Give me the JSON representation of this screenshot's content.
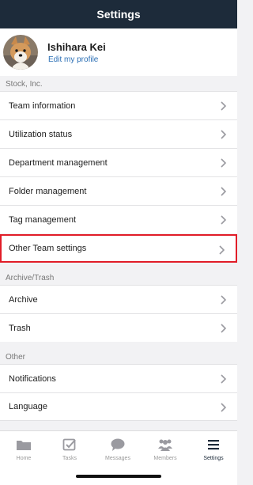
{
  "header": {
    "title": "Settings"
  },
  "profile": {
    "name": "Ishihara Kei",
    "edit_link": "Edit my profile"
  },
  "sections": [
    {
      "title": "Stock, Inc.",
      "items": [
        "Team information",
        "Utilization status",
        "Department management",
        "Folder management",
        "Tag management",
        "Other Team settings"
      ]
    },
    {
      "title": "Archive/Trash",
      "items": [
        "Archive",
        "Trash"
      ]
    },
    {
      "title": "Other",
      "items": [
        "Notifications",
        "Language"
      ]
    }
  ],
  "tabbar": {
    "tabs": [
      {
        "label": "Home",
        "icon": "folder-icon"
      },
      {
        "label": "Tasks",
        "icon": "checkbox-icon"
      },
      {
        "label": "Messages",
        "icon": "chat-bubble-icon"
      },
      {
        "label": "Members",
        "icon": "people-icon"
      },
      {
        "label": "Settings",
        "icon": "hamburger-menu-icon"
      }
    ],
    "active": "Settings"
  },
  "colors": {
    "header_bg": "#1d2b3a",
    "link": "#2b6fb5",
    "highlight_border": "#e11d28",
    "background": "#f2f2f4"
  }
}
